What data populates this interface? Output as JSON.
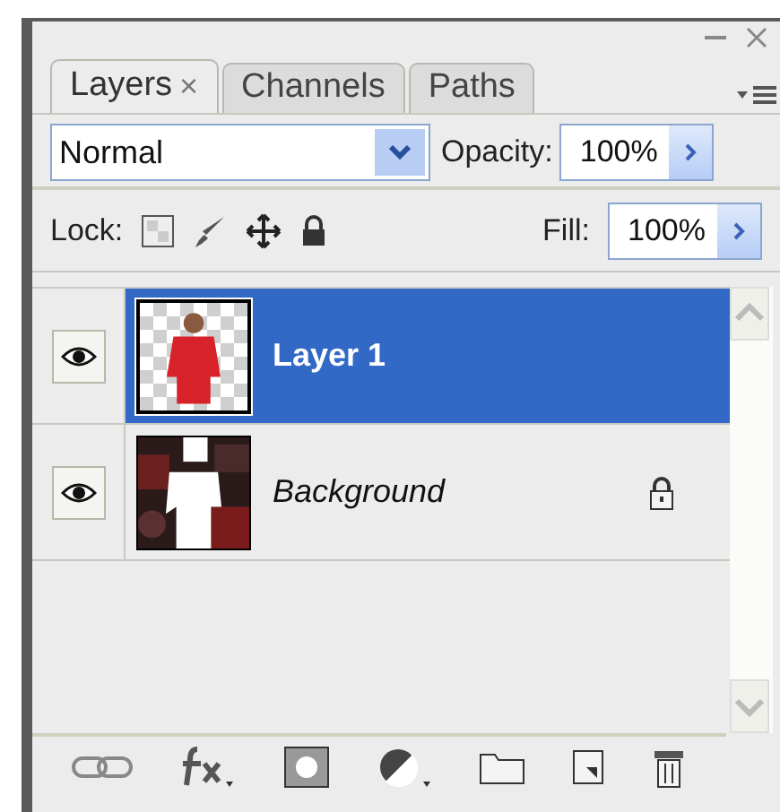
{
  "tabs": [
    {
      "label": "Layers",
      "close": "×",
      "selected": true
    },
    {
      "label": "Channels",
      "selected": false
    },
    {
      "label": "Paths",
      "selected": false
    }
  ],
  "blend_mode": {
    "value": "Normal"
  },
  "opacity": {
    "label": "Opacity:",
    "value": "100%"
  },
  "lock": {
    "label": "Lock:"
  },
  "fill": {
    "label": "Fill:",
    "value": "100%"
  },
  "layers": [
    {
      "name": "Layer 1",
      "kind": "normal",
      "visible": true,
      "locked": false,
      "selected": true
    },
    {
      "name": "Background",
      "kind": "background",
      "visible": true,
      "locked": true,
      "selected": false
    }
  ]
}
